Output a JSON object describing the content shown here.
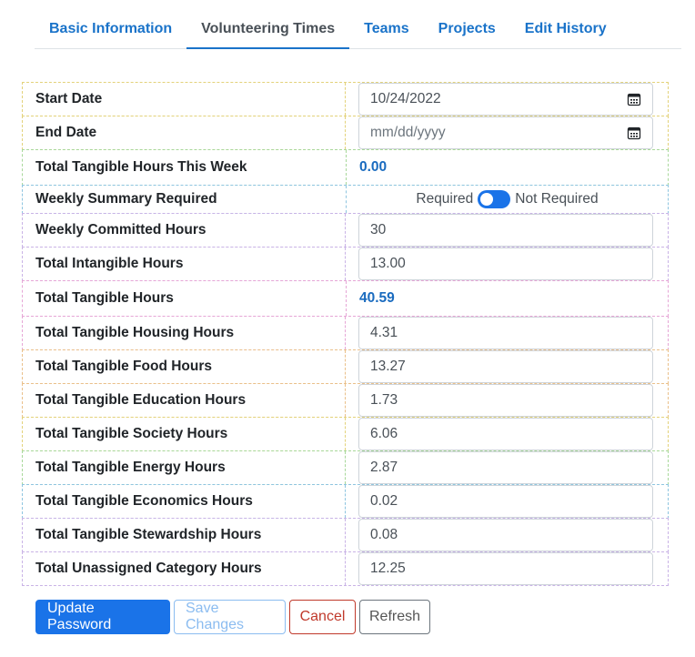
{
  "tabs": [
    {
      "label": "Basic Information",
      "active": false
    },
    {
      "label": "Volunteering Times",
      "active": true
    },
    {
      "label": "Teams",
      "active": false
    },
    {
      "label": "Projects",
      "active": false
    },
    {
      "label": "Edit History",
      "active": false
    }
  ],
  "form": {
    "start_date": {
      "label": "Start Date",
      "value": "10/24/2022"
    },
    "end_date": {
      "label": "End Date",
      "placeholder": "mm/dd/yyyy"
    },
    "tangible_this_week": {
      "label": "Total Tangible Hours This Week",
      "value": "0.00"
    },
    "weekly_summary": {
      "label": "Weekly Summary Required",
      "left": "Required",
      "right": "Not Required"
    },
    "weekly_committed": {
      "label": "Weekly Committed Hours",
      "value": "30"
    },
    "intangible": {
      "label": "Total Intangible Hours",
      "value": "13.00"
    },
    "tangible_total": {
      "label": "Total Tangible Hours",
      "value": "40.59"
    },
    "housing": {
      "label": "Total Tangible Housing Hours",
      "value": "4.31"
    },
    "food": {
      "label": "Total Tangible Food Hours",
      "value": "13.27"
    },
    "education": {
      "label": "Total Tangible Education Hours",
      "value": "1.73"
    },
    "society": {
      "label": "Total Tangible Society Hours",
      "value": "6.06"
    },
    "energy": {
      "label": "Total Tangible Energy Hours",
      "value": "2.87"
    },
    "economics": {
      "label": "Total Tangible Economics Hours",
      "value": "0.02"
    },
    "stewardship": {
      "label": "Total Tangible Stewardship Hours",
      "value": "0.08"
    },
    "unassigned": {
      "label": "Total Unassigned Category Hours",
      "value": "12.25"
    }
  },
  "buttons": {
    "update_password": "Update Password",
    "save_changes": "Save Changes",
    "cancel": "Cancel",
    "refresh": "Refresh"
  },
  "colors": {
    "primary": "#1a73e8",
    "link": "#1a73c9",
    "value": "#1a6bbf",
    "danger": "#c0392b"
  },
  "icons": {
    "calendar": "calendar-icon"
  }
}
